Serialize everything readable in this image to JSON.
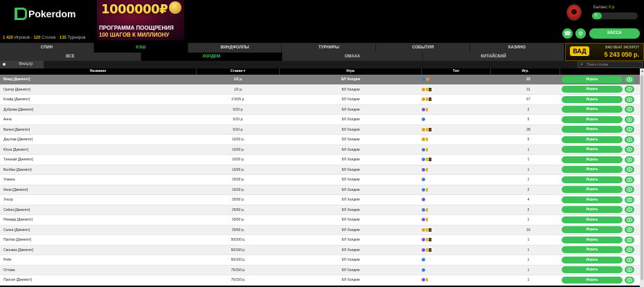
{
  "brand": {
    "name": "Pokerdom"
  },
  "stats": {
    "players_count": "1 420",
    "players_label": "Игроков",
    "tables_count": "120",
    "tables_label": "Столов",
    "tournaments_count": "135",
    "tournaments_label": "Турниров"
  },
  "banner": {
    "amount": "1000000₽",
    "line1": "ПРОГРАММА ПООЩРЕНИЯ",
    "line2": "100 ШАГОВ К МИЛЛИОНУ"
  },
  "account": {
    "balance_label": "Баланс",
    "balance_value": "0 р",
    "bar_value": "0",
    "cash_label": "КАССА"
  },
  "jackpot": {
    "badge": "ВАД",
    "label": "BAD BEAT JACKPOT",
    "value": "5 243 050 р."
  },
  "game_tabs": [
    {
      "label": "СПИН",
      "active": false
    },
    {
      "label": "КЭШ",
      "active": true
    },
    {
      "label": "ВИНДФОЛЛЫ",
      "active": false
    },
    {
      "label": "ТУРНИРЫ",
      "active": false
    },
    {
      "label": "СОБЫТИЯ",
      "active": false
    },
    {
      "label": "КАЗИНО",
      "active": false
    }
  ],
  "sub_tabs": [
    {
      "label": "ВСЕ",
      "active": false
    },
    {
      "label": "ХОЛДЕМ",
      "active": true
    },
    {
      "label": "ОМАХА",
      "active": false
    },
    {
      "label": "КИТАЙСКИЙ",
      "active": false
    }
  ],
  "filter": {
    "label": "Фильтр",
    "search_placeholder": "Поиск столов"
  },
  "columns": {
    "name": "Название",
    "stakes": "Ставки ▾",
    "game": "Игра",
    "type": "Тип",
    "players": "Игр."
  },
  "play_label": "Играть",
  "rows": [
    {
      "name": "Виид [Джекпот]",
      "stake": "1/2 р.",
      "game": "БЛ Холдем",
      "type": [
        "bl",
        "or"
      ],
      "players": "22",
      "selected": true
    },
    {
      "name": "Григор [Джекпот]",
      "stake": "1/2 р.",
      "game": "БЛ Холдем",
      "type": [
        "or",
        "tag",
        "box"
      ],
      "players": "31"
    },
    {
      "name": "Клайд [Джекпот]",
      "stake": "2.50/5 р.",
      "game": "БЛ Холдем",
      "type": [
        "or",
        "tag",
        "box"
      ],
      "players": "67"
    },
    {
      "name": "Дуброва [Джекпот]",
      "stake": "5/10 р.",
      "game": "БЛ Холдем",
      "type": [
        "pu",
        "tag"
      ],
      "players": "2"
    },
    {
      "name": "Анна",
      "stake": "5/10 р.",
      "game": "БЛ Холдем",
      "type": [
        "bl"
      ],
      "players": "5"
    },
    {
      "name": "Валеи [Джекпот]",
      "stake": "5/10 р.",
      "game": "БЛ Холдем",
      "type": [
        "or",
        "tag",
        "box"
      ],
      "players": "28"
    },
    {
      "name": "Дауглав [Джекпот]",
      "stake": "10/20 р.",
      "game": "БЛ Холдем",
      "type": [
        "or",
        "tag"
      ],
      "players": "5"
    },
    {
      "name": "Юнга [Джекпот]",
      "stake": "10/20 р.",
      "game": "БЛ Холдем",
      "type": [
        "bl",
        "tag"
      ],
      "players": "1"
    },
    {
      "name": "Тачанай [Джекпот]",
      "stake": "10/20 р.",
      "game": "БЛ Холдем",
      "type": [
        "bl",
        "tag",
        "box"
      ],
      "players": "1"
    },
    {
      "name": "Велбан [Джекпот]",
      "stake": "10/20 р.",
      "game": "БЛ Холдем",
      "type": [
        "pu",
        "tag"
      ],
      "players": "1"
    },
    {
      "name": "Уланка",
      "stake": "15/30 р.",
      "game": "БЛ Холдем",
      "type": [
        "bl"
      ],
      "players": "1"
    },
    {
      "name": "Инов [Джекпот]",
      "stake": "15/30 р.",
      "game": "БЛ Холдем",
      "type": [
        "bl",
        "tag"
      ],
      "players": "2"
    },
    {
      "name": "Унсор",
      "stake": "25/50 р.",
      "game": "БЛ Холдем",
      "type": [
        "pu"
      ],
      "players": "4"
    },
    {
      "name": "Сейли [Джекпот]",
      "stake": "25/50 р.",
      "game": "БЛ Холдем",
      "type": [
        "bl",
        "tag"
      ],
      "players": "2"
    },
    {
      "name": "Немида [Джекпот]",
      "stake": "25/50 р.",
      "game": "БЛ Холдем",
      "type": [
        "pu",
        "tag"
      ],
      "players": "1"
    },
    {
      "name": "Салка [Джекпот]",
      "stake": "25/50 р.",
      "game": "БЛ Холдем",
      "type": [
        "or",
        "tag",
        "box"
      ],
      "players": "16"
    },
    {
      "name": "Протва [Джекпот]",
      "stake": "50/100 р.",
      "game": "БЛ Холдем",
      "type": [
        "pu",
        "tag",
        "box"
      ],
      "players": "1"
    },
    {
      "name": "Своника [Джекпот]",
      "stake": "50/100 р.",
      "game": "БЛ Холдем",
      "type": [
        "pu",
        "tag",
        "box"
      ],
      "players": "1"
    },
    {
      "name": "Рейн",
      "stake": "50/100 р.",
      "game": "БЛ Холдем",
      "type": [
        "bl"
      ],
      "players": "1"
    },
    {
      "name": "Оттава",
      "stake": "75/150 р.",
      "game": "БЛ Холдем",
      "type": [
        "bl"
      ],
      "players": "1"
    },
    {
      "name": "Просне [Джекпот]",
      "stake": "75/150 р.",
      "game": "БЛ Холдем",
      "type": [
        "pu",
        "tag"
      ],
      "players": "1"
    }
  ]
}
